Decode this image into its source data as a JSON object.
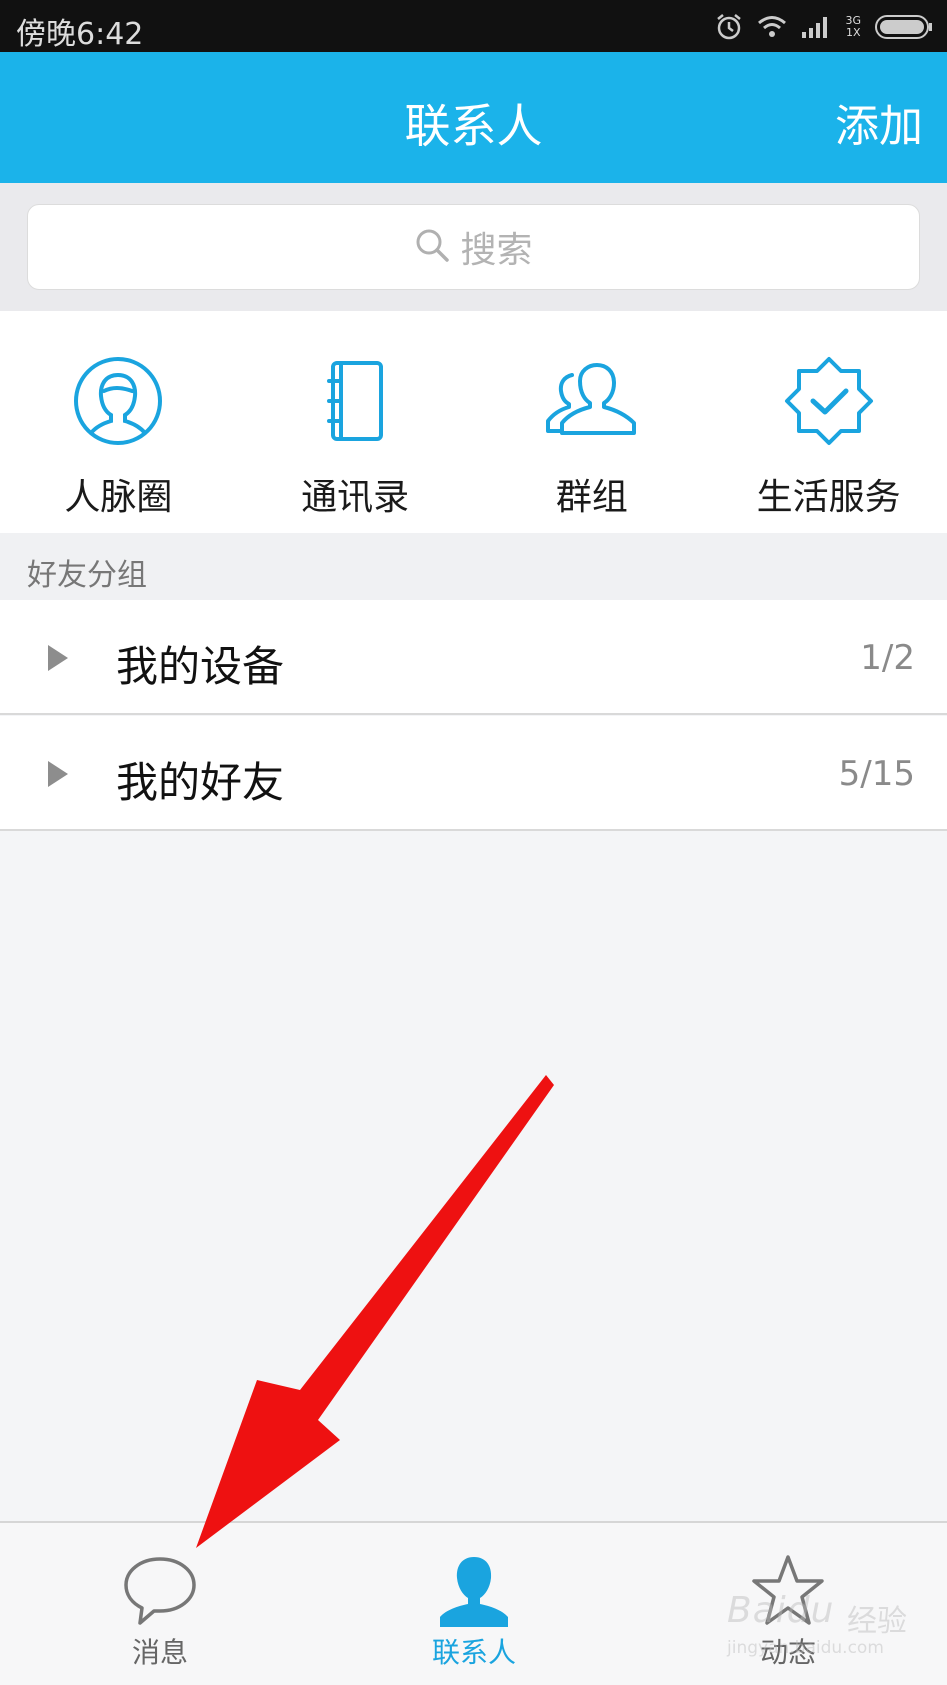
{
  "status_bar": {
    "time": "傍晚6:42",
    "network_top": "3G",
    "network_bottom": "1X",
    "icons": [
      "alarm-icon",
      "wifi-icon",
      "signal-icon",
      "battery-icon"
    ]
  },
  "nav": {
    "title": "联系人",
    "add_label": "添加",
    "color": "#1bb3ea"
  },
  "search": {
    "placeholder": "搜索"
  },
  "quick_actions": [
    {
      "label": "人脉圈",
      "icon": "contact-circle-icon"
    },
    {
      "label": "通讯录",
      "icon": "address-book-icon"
    },
    {
      "label": "群组",
      "icon": "group-icon"
    },
    {
      "label": "生活服务",
      "icon": "verified-badge-icon"
    }
  ],
  "friend_groups": {
    "header": "好友分组",
    "items": [
      {
        "name": "我的设备",
        "count": "1/2"
      },
      {
        "name": "我的好友",
        "count": "5/15"
      }
    ]
  },
  "tab_bar": {
    "tabs": [
      {
        "label": "消息",
        "icon": "chat-bubble-icon",
        "active": false
      },
      {
        "label": "联系人",
        "icon": "person-icon",
        "active": true
      },
      {
        "label": "动态",
        "icon": "star-icon",
        "active": false
      }
    ],
    "active_color": "#1aa4df"
  },
  "watermark": {
    "brand": "Baidu",
    "label": "经验",
    "url": "jingyan.baidu.com"
  },
  "annotation": {
    "arrow_color": "#ee1111"
  }
}
